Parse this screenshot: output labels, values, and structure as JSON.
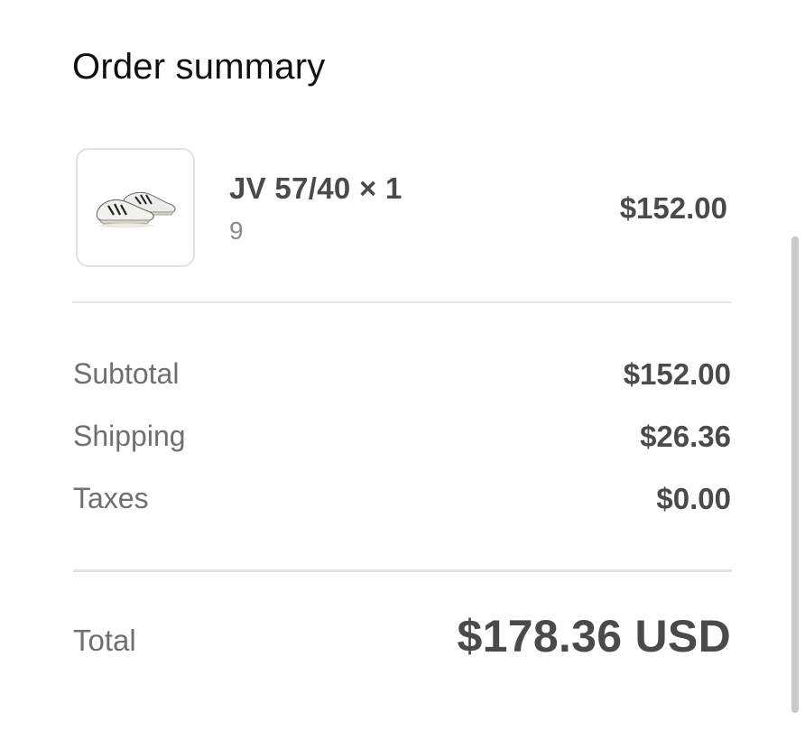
{
  "header": {
    "title": "Order summary"
  },
  "line_items": [
    {
      "name": "JV 57/40 × 1",
      "variant": "9",
      "price": "$152.00",
      "image_icon": "sneaker-thumbnail"
    }
  ],
  "summary": {
    "subtotal_label": "Subtotal",
    "subtotal_value": "$152.00",
    "shipping_label": "Shipping",
    "shipping_value": "$26.36",
    "taxes_label": "Taxes",
    "taxes_value": "$0.00"
  },
  "total": {
    "label": "Total",
    "value": "$178.36 USD"
  },
  "colors": {
    "text_primary": "#4a4a4a",
    "text_secondary": "#6f6f6f",
    "text_muted": "#8c8c8c",
    "divider": "#e6e6e6"
  }
}
